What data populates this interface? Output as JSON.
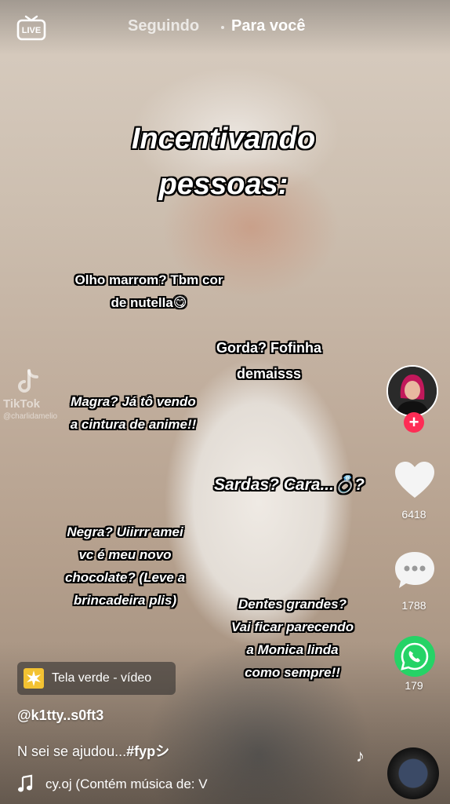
{
  "header": {
    "live_label": "LIVE",
    "tab_following": "Seguindo",
    "tab_for_you": "Para você"
  },
  "video": {
    "title_line1": "Incentivando",
    "title_line2": "pessoas:",
    "captions": {
      "c1_line1": "Olho marrom? Tbm  cor",
      "c1_line2": "de nutella😋",
      "c2_line1": "Gorda? Fofinha",
      "c2_line2": "demaisss",
      "c3_line1": "Magra? Já tô vendo",
      "c3_line2": "a cintura de anime!!",
      "c4_line1": "Sardas? Cara...💍?",
      "c5_line1": "Negra? Uiirrr amei",
      "c5_line2": "vc é meu novo",
      "c5_line3": "chocolate? (Leve a",
      "c5_line4": "brincadeira plis)",
      "c6_line1": "Dentes grandes?",
      "c6_line2": "Vai ficar parecendo",
      "c6_line3": "a Monica linda",
      "c6_line4": "como sempre!!"
    },
    "watermark_brand": "TikTok",
    "watermark_user": "@charlidamelio"
  },
  "actions": {
    "likes": "6418",
    "comments": "1788",
    "shares": "179"
  },
  "info": {
    "effect_label": "Tela verde - vídeo",
    "username": "@k1tty..s0ft3",
    "description_text": "N sei se ajudou...",
    "description_tag": "#fypシ",
    "music_text": "cy.oj (Contém música de: V"
  },
  "colors": {
    "accent": "#fe2c55",
    "whatsapp": "#25d366",
    "effect_icon": "#f3c232"
  }
}
